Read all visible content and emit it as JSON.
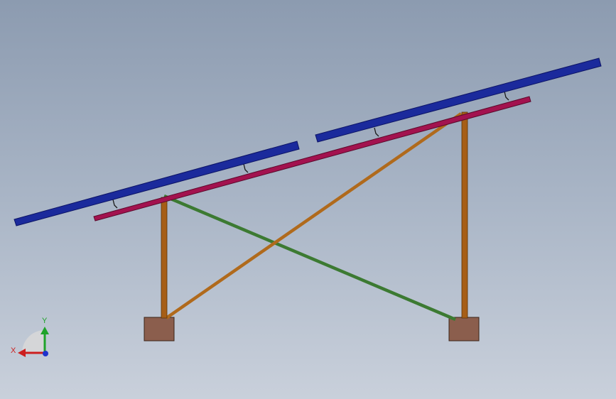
{
  "triad": {
    "x_label": "X",
    "y_label": "Y",
    "x_color": "#cc1f1f",
    "y_color": "#1fa32a",
    "z_color": "#1f33cc"
  },
  "colors": {
    "solar_panel": "#1b2a9c",
    "solar_panel_edge": "#0c1466",
    "purlin": "#a3124f",
    "purlin_edge": "#5c0a2c",
    "column": "#a65e16",
    "column_edge": "#5e3406",
    "brace_orange": "#b06a1c",
    "brace_green": "#3c7a32",
    "footing": "#8b5e4d",
    "footing_edge": "#3a2418",
    "clamp": "#1a1a1a"
  }
}
